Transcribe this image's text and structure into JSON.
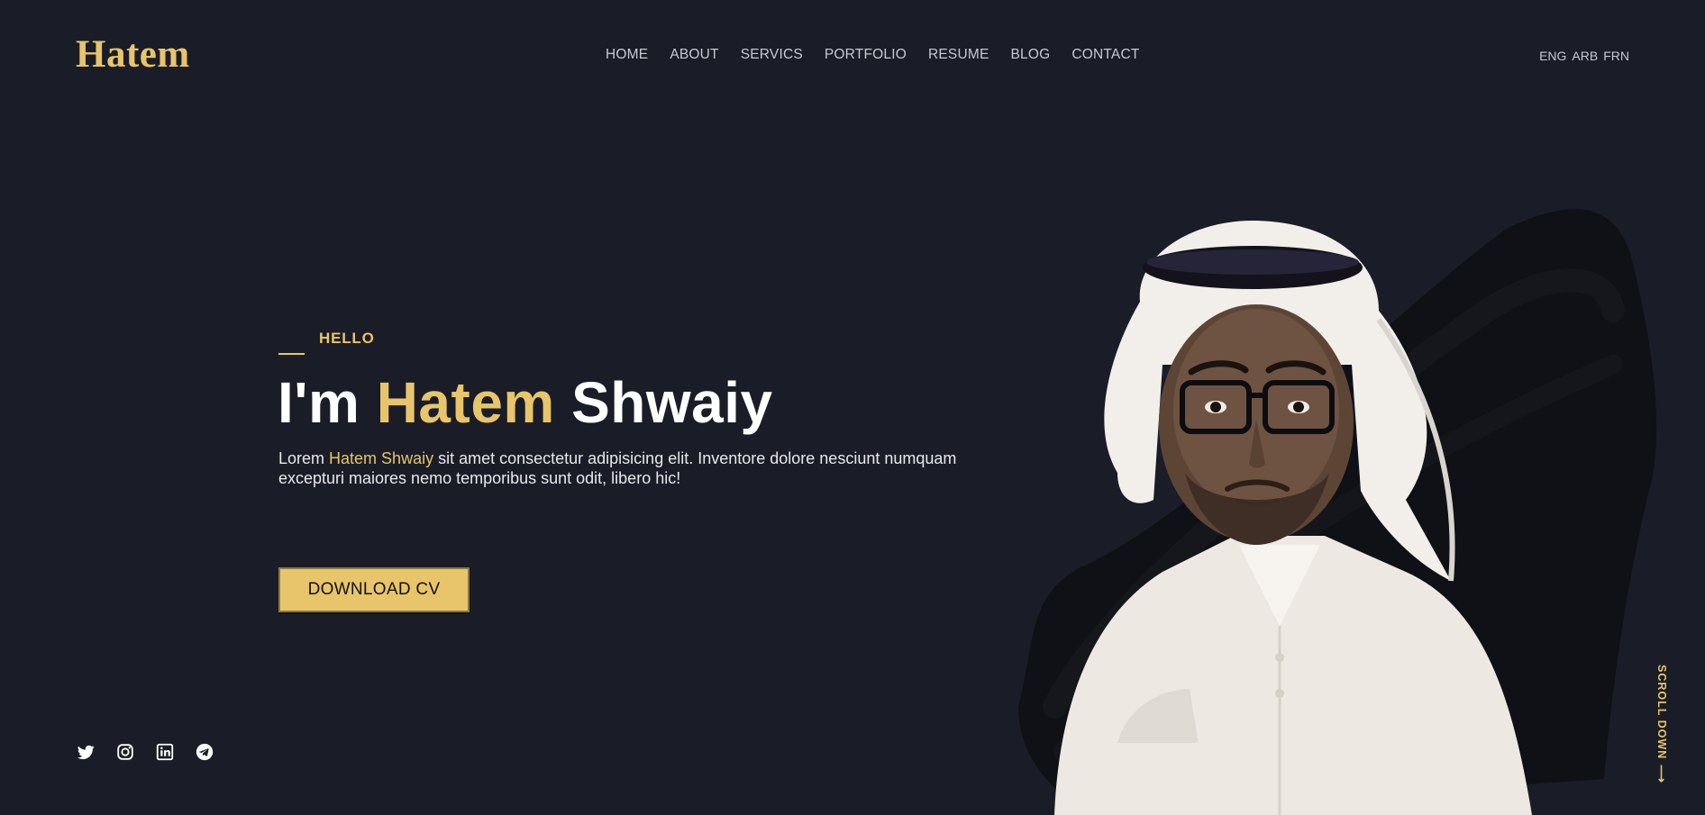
{
  "brand": {
    "logo": "Hatem"
  },
  "nav": {
    "items": [
      {
        "label": "HOME"
      },
      {
        "label": "ABOUT"
      },
      {
        "label": "SERVICS"
      },
      {
        "label": "PORTFOLIO"
      },
      {
        "label": "RESUME"
      },
      {
        "label": "BLOG"
      },
      {
        "label": "CONTACT"
      }
    ]
  },
  "languages": [
    "ENG",
    "ARB",
    "FRN"
  ],
  "hero": {
    "eyebrow": "HELLO",
    "title_prefix": "I'm ",
    "title_highlight": "Hatem",
    "title_suffix": " Shwaiy",
    "desc_prefix": "Lorem ",
    "desc_highlight": "Hatem Shwaiy",
    "desc_suffix": " sit amet consectetur adipisicing elit. Inventore dolore nesciunt numquam excepturi maiores nemo temporibus sunt odit, libero hic!",
    "cta_label": "DOWNLOAD CV"
  },
  "social": [
    "twitter-icon",
    "instagram-icon",
    "linkedin-icon",
    "telegram-icon"
  ],
  "scroll": {
    "label": "SCROLL DOWN",
    "arrow": "⟶"
  },
  "colors": {
    "background": "#1a1d27",
    "accent": "#e8c56a",
    "text": "#ffffff",
    "muted": "#c8cad2"
  }
}
